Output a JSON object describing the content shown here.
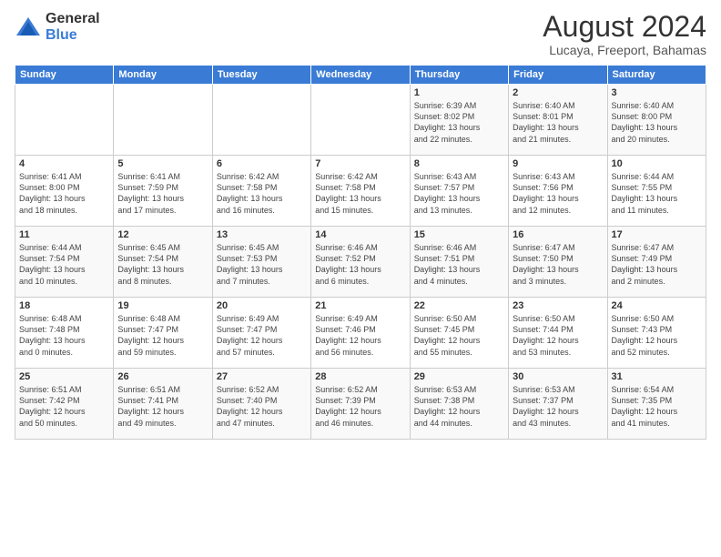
{
  "logo": {
    "general": "General",
    "blue": "Blue"
  },
  "title": "August 2024",
  "location": "Lucaya, Freeport, Bahamas",
  "days_of_week": [
    "Sunday",
    "Monday",
    "Tuesday",
    "Wednesday",
    "Thursday",
    "Friday",
    "Saturday"
  ],
  "weeks": [
    [
      {
        "day": "",
        "info": ""
      },
      {
        "day": "",
        "info": ""
      },
      {
        "day": "",
        "info": ""
      },
      {
        "day": "",
        "info": ""
      },
      {
        "day": "1",
        "info": "Sunrise: 6:39 AM\nSunset: 8:02 PM\nDaylight: 13 hours\nand 22 minutes."
      },
      {
        "day": "2",
        "info": "Sunrise: 6:40 AM\nSunset: 8:01 PM\nDaylight: 13 hours\nand 21 minutes."
      },
      {
        "day": "3",
        "info": "Sunrise: 6:40 AM\nSunset: 8:00 PM\nDaylight: 13 hours\nand 20 minutes."
      }
    ],
    [
      {
        "day": "4",
        "info": "Sunrise: 6:41 AM\nSunset: 8:00 PM\nDaylight: 13 hours\nand 18 minutes."
      },
      {
        "day": "5",
        "info": "Sunrise: 6:41 AM\nSunset: 7:59 PM\nDaylight: 13 hours\nand 17 minutes."
      },
      {
        "day": "6",
        "info": "Sunrise: 6:42 AM\nSunset: 7:58 PM\nDaylight: 13 hours\nand 16 minutes."
      },
      {
        "day": "7",
        "info": "Sunrise: 6:42 AM\nSunset: 7:58 PM\nDaylight: 13 hours\nand 15 minutes."
      },
      {
        "day": "8",
        "info": "Sunrise: 6:43 AM\nSunset: 7:57 PM\nDaylight: 13 hours\nand 13 minutes."
      },
      {
        "day": "9",
        "info": "Sunrise: 6:43 AM\nSunset: 7:56 PM\nDaylight: 13 hours\nand 12 minutes."
      },
      {
        "day": "10",
        "info": "Sunrise: 6:44 AM\nSunset: 7:55 PM\nDaylight: 13 hours\nand 11 minutes."
      }
    ],
    [
      {
        "day": "11",
        "info": "Sunrise: 6:44 AM\nSunset: 7:54 PM\nDaylight: 13 hours\nand 10 minutes."
      },
      {
        "day": "12",
        "info": "Sunrise: 6:45 AM\nSunset: 7:54 PM\nDaylight: 13 hours\nand 8 minutes."
      },
      {
        "day": "13",
        "info": "Sunrise: 6:45 AM\nSunset: 7:53 PM\nDaylight: 13 hours\nand 7 minutes."
      },
      {
        "day": "14",
        "info": "Sunrise: 6:46 AM\nSunset: 7:52 PM\nDaylight: 13 hours\nand 6 minutes."
      },
      {
        "day": "15",
        "info": "Sunrise: 6:46 AM\nSunset: 7:51 PM\nDaylight: 13 hours\nand 4 minutes."
      },
      {
        "day": "16",
        "info": "Sunrise: 6:47 AM\nSunset: 7:50 PM\nDaylight: 13 hours\nand 3 minutes."
      },
      {
        "day": "17",
        "info": "Sunrise: 6:47 AM\nSunset: 7:49 PM\nDaylight: 13 hours\nand 2 minutes."
      }
    ],
    [
      {
        "day": "18",
        "info": "Sunrise: 6:48 AM\nSunset: 7:48 PM\nDaylight: 13 hours\nand 0 minutes."
      },
      {
        "day": "19",
        "info": "Sunrise: 6:48 AM\nSunset: 7:47 PM\nDaylight: 12 hours\nand 59 minutes."
      },
      {
        "day": "20",
        "info": "Sunrise: 6:49 AM\nSunset: 7:47 PM\nDaylight: 12 hours\nand 57 minutes."
      },
      {
        "day": "21",
        "info": "Sunrise: 6:49 AM\nSunset: 7:46 PM\nDaylight: 12 hours\nand 56 minutes."
      },
      {
        "day": "22",
        "info": "Sunrise: 6:50 AM\nSunset: 7:45 PM\nDaylight: 12 hours\nand 55 minutes."
      },
      {
        "day": "23",
        "info": "Sunrise: 6:50 AM\nSunset: 7:44 PM\nDaylight: 12 hours\nand 53 minutes."
      },
      {
        "day": "24",
        "info": "Sunrise: 6:50 AM\nSunset: 7:43 PM\nDaylight: 12 hours\nand 52 minutes."
      }
    ],
    [
      {
        "day": "25",
        "info": "Sunrise: 6:51 AM\nSunset: 7:42 PM\nDaylight: 12 hours\nand 50 minutes."
      },
      {
        "day": "26",
        "info": "Sunrise: 6:51 AM\nSunset: 7:41 PM\nDaylight: 12 hours\nand 49 minutes."
      },
      {
        "day": "27",
        "info": "Sunrise: 6:52 AM\nSunset: 7:40 PM\nDaylight: 12 hours\nand 47 minutes."
      },
      {
        "day": "28",
        "info": "Sunrise: 6:52 AM\nSunset: 7:39 PM\nDaylight: 12 hours\nand 46 minutes."
      },
      {
        "day": "29",
        "info": "Sunrise: 6:53 AM\nSunset: 7:38 PM\nDaylight: 12 hours\nand 44 minutes."
      },
      {
        "day": "30",
        "info": "Sunrise: 6:53 AM\nSunset: 7:37 PM\nDaylight: 12 hours\nand 43 minutes."
      },
      {
        "day": "31",
        "info": "Sunrise: 6:54 AM\nSunset: 7:35 PM\nDaylight: 12 hours\nand 41 minutes."
      }
    ]
  ]
}
